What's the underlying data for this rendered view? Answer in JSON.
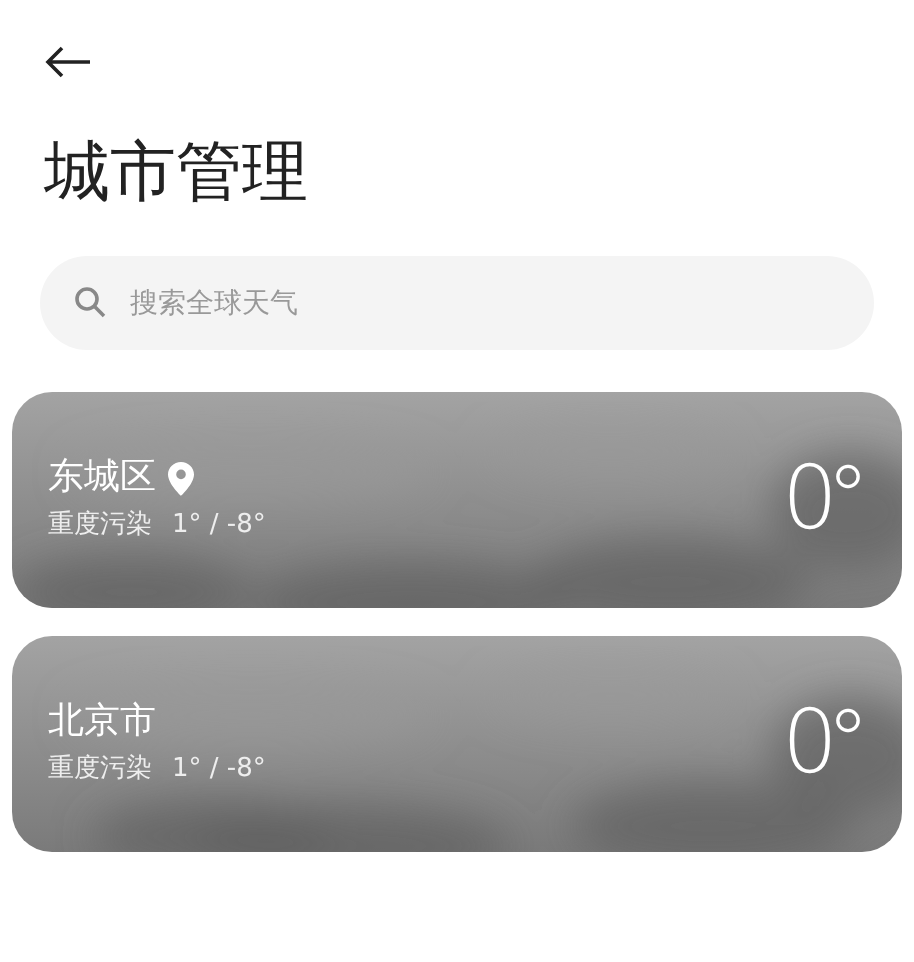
{
  "title": "城市管理",
  "search": {
    "placeholder": "搜索全球天气"
  },
  "cities": [
    {
      "name": "东城区",
      "located": true,
      "air": "重度污染",
      "range": "1° / -8°",
      "temp": "0°"
    },
    {
      "name": "北京市",
      "located": false,
      "air": "重度污染",
      "range": "1° / -8°",
      "temp": "0°"
    }
  ]
}
